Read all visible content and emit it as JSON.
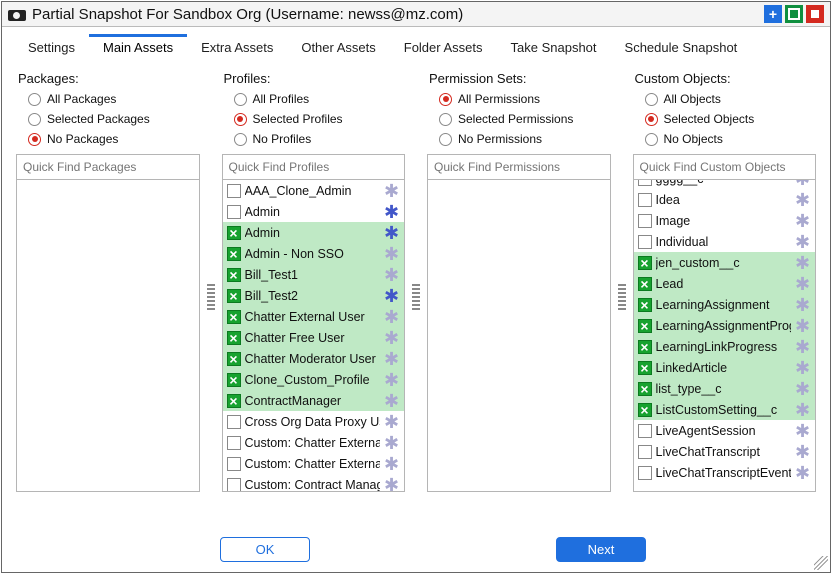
{
  "window": {
    "title": "Partial Snapshot For Sandbox Org (Username: newss@mz.com)"
  },
  "tabs": [
    {
      "label": "Settings",
      "active": false
    },
    {
      "label": "Main Assets",
      "active": true
    },
    {
      "label": "Extra Assets",
      "active": false
    },
    {
      "label": "Other Assets",
      "active": false
    },
    {
      "label": "Folder Assets",
      "active": false
    },
    {
      "label": "Take Snapshot",
      "active": false
    },
    {
      "label": "Schedule Snapshot",
      "active": false
    }
  ],
  "packages": {
    "heading": "Packages:",
    "options": [
      {
        "label": "All Packages",
        "selected": false
      },
      {
        "label": "Selected Packages",
        "selected": false
      },
      {
        "label": "No Packages",
        "selected": true
      }
    ],
    "search_placeholder": "Quick Find Packages",
    "items": []
  },
  "profiles": {
    "heading": "Profiles:",
    "options": [
      {
        "label": "All Profiles",
        "selected": false
      },
      {
        "label": "Selected Profiles",
        "selected": true
      },
      {
        "label": "No Profiles",
        "selected": false
      }
    ],
    "search_placeholder": "Quick Find Profiles",
    "items": [
      {
        "label": "AAA_Clone_Admin",
        "selected": false
      },
      {
        "label": "Admin",
        "selected": false,
        "star": "blue"
      },
      {
        "label": "Admin",
        "selected": true,
        "star": "blue"
      },
      {
        "label": "Admin - Non SSO",
        "selected": true
      },
      {
        "label": "Bill_Test1",
        "selected": true
      },
      {
        "label": "Bill_Test2",
        "selected": true,
        "star": "blue"
      },
      {
        "label": "Chatter External User",
        "selected": true
      },
      {
        "label": "Chatter Free User",
        "selected": true
      },
      {
        "label": "Chatter Moderator User",
        "selected": true
      },
      {
        "label": "Clone_Custom_Profile",
        "selected": true
      },
      {
        "label": "ContractManager",
        "selected": true
      },
      {
        "label": "Cross Org Data Proxy User",
        "selected": false
      },
      {
        "label": "Custom: Chatter External",
        "selected": false
      },
      {
        "label": "Custom: Chatter External",
        "selected": false
      },
      {
        "label": "Custom: Contract Manager",
        "selected": false
      }
    ]
  },
  "permission_sets": {
    "heading": "Permission Sets:",
    "options": [
      {
        "label": "All Permissions",
        "selected": true
      },
      {
        "label": "Selected Permissions",
        "selected": false
      },
      {
        "label": "No Permissions",
        "selected": false
      }
    ],
    "search_placeholder": "Quick Find Permissions",
    "items": []
  },
  "custom_objects": {
    "heading": "Custom Objects:",
    "options": [
      {
        "label": "All Objects",
        "selected": false
      },
      {
        "label": "Selected Objects",
        "selected": true
      },
      {
        "label": "No Objects",
        "selected": false
      }
    ],
    "search_placeholder": "Quick Find Custom Objects",
    "items": [
      {
        "label": "gggg__c",
        "selected": false,
        "partial": true
      },
      {
        "label": "Idea",
        "selected": false
      },
      {
        "label": "Image",
        "selected": false
      },
      {
        "label": "Individual",
        "selected": false
      },
      {
        "label": "jen_custom__c",
        "selected": true
      },
      {
        "label": "Lead",
        "selected": true
      },
      {
        "label": "LearningAssignment",
        "selected": true
      },
      {
        "label": "LearningAssignmentProgress",
        "selected": true
      },
      {
        "label": "LearningLinkProgress",
        "selected": true
      },
      {
        "label": "LinkedArticle",
        "selected": true
      },
      {
        "label": "list_type__c",
        "selected": true
      },
      {
        "label": "ListCustomSetting__c",
        "selected": true
      },
      {
        "label": "LiveAgentSession",
        "selected": false
      },
      {
        "label": "LiveChatTranscript",
        "selected": false
      },
      {
        "label": "LiveChatTranscriptEvent",
        "selected": false
      }
    ]
  },
  "footer": {
    "ok": "OK",
    "next": "Next"
  }
}
